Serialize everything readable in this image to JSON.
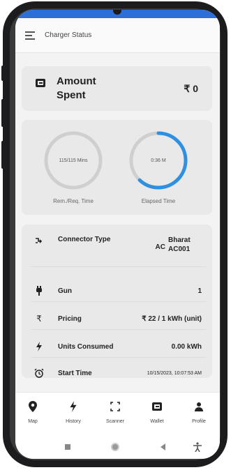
{
  "header": {
    "title": "Charger Status",
    "menu_icon": "menu-icon"
  },
  "amount": {
    "label": "Amount Spent",
    "value": "₹ 0",
    "icon": "wallet-icon"
  },
  "timers": {
    "remaining": {
      "text": "115/115 Mins",
      "label": "Rem./Req. Time",
      "progress": 0
    },
    "elapsed": {
      "text": "0:36 M",
      "label": "Elapsed Time",
      "progress": 0.62
    }
  },
  "details": [
    {
      "icon": "connector-icon",
      "label": "Connector Type",
      "prefix": "AC",
      "value": "Bharat AC001"
    },
    {
      "icon": "gun-icon",
      "label": "Gun",
      "value": "1"
    },
    {
      "icon": "rupee-icon",
      "label": "Pricing",
      "value": "₹ 22 / 1 kWh (unit)"
    },
    {
      "icon": "bolt-icon",
      "label": "Units Consumed",
      "value": "0.00 kWh"
    },
    {
      "icon": "alarm-clock-icon",
      "label": "Start Time",
      "value": "10/15/2023, 10:07:53 AM"
    }
  ],
  "bottom_nav": [
    {
      "label": "Map",
      "icon": "location-pin-icon"
    },
    {
      "label": "History",
      "icon": "bolt-icon"
    },
    {
      "label": "Scanner",
      "icon": "scan-icon"
    },
    {
      "label": "Wallet",
      "icon": "wallet-icon"
    },
    {
      "label": "Profile",
      "icon": "person-icon"
    }
  ],
  "system_nav": [
    "square-icon",
    "home-circle-icon",
    "back-triangle-icon",
    "accessibility-icon"
  ],
  "colors": {
    "accent": "#2f8fe0",
    "ring_track": "#cfcfcf",
    "status_bar": "#2d6fd8"
  }
}
